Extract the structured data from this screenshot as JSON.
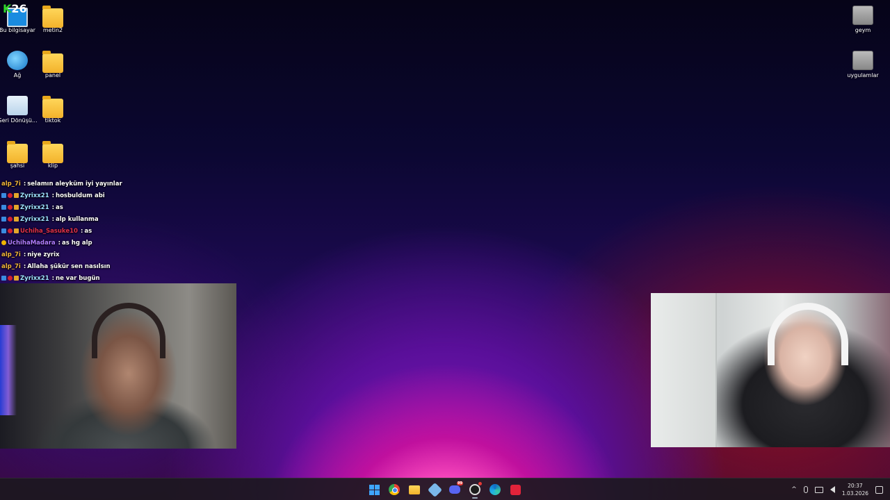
{
  "overlay": {
    "k": "K",
    "num": "26"
  },
  "desktop": {
    "left_icons": [
      {
        "label": "Bu bilgisayar"
      },
      {
        "label": "metin2"
      },
      {
        "label": "Ağ"
      },
      {
        "label": "panel"
      },
      {
        "label": "Geri Dönüşü..."
      },
      {
        "label": "tiktok"
      },
      {
        "label": "şahsi"
      },
      {
        "label": "klip"
      }
    ],
    "right_icons": [
      {
        "label": "geym"
      },
      {
        "label": "uygulamlar"
      }
    ]
  },
  "chat": {
    "messages": [
      {
        "user": "alp_7i",
        "text": "selamın aleyküm iyi yayınlar",
        "color": "#f0b43a"
      },
      {
        "user": "Zyrixx21",
        "text": "hosbuldum abi",
        "color": "#9fe3ff"
      },
      {
        "user": "Zyrixx21",
        "text": "as",
        "color": "#9fe3ff"
      },
      {
        "user": "Zyrixx21",
        "text": "alp kullanma",
        "color": "#9fe3ff"
      },
      {
        "user": "Uchiha_Sasuke10",
        "text": "as",
        "color": "#e0304a"
      },
      {
        "user": "UchihaMadara",
        "text": "as hg alp",
        "color": "#b07cff"
      },
      {
        "user": "alp_7i",
        "text": "niye zyrix",
        "color": "#f0b43a"
      },
      {
        "user": "alp_7i",
        "text": "Allaha şükür sen nasılsın",
        "color": "#f0b43a"
      },
      {
        "user": "Zyrixx21",
        "text": "ne var bugün",
        "color": "#9fe3ff"
      }
    ],
    "separator": " : "
  },
  "taskbar": {
    "discord_badge": "99",
    "clock_time": "20:37",
    "clock_date": "1.03.2026",
    "tray_chevron": "^"
  }
}
